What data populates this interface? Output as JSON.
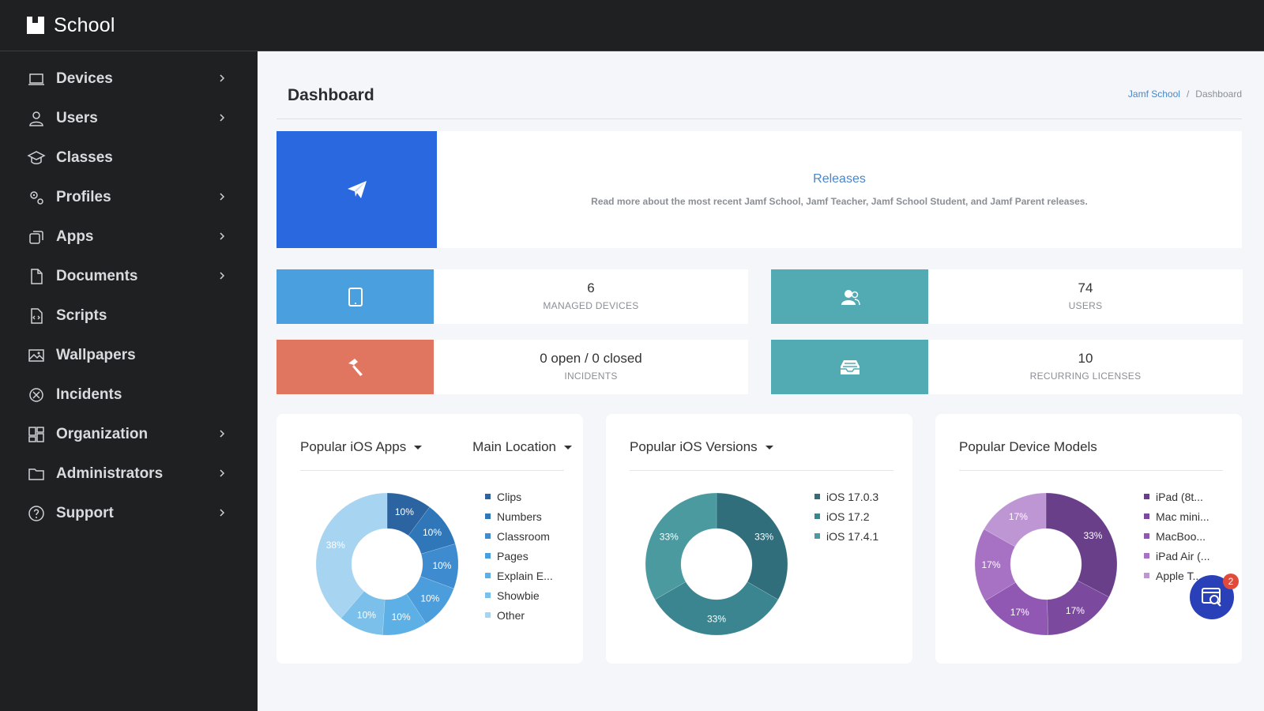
{
  "app": {
    "brand": "School"
  },
  "sidebar": {
    "items": [
      {
        "label": "Devices",
        "icon": "laptop-icon",
        "has_children": true
      },
      {
        "label": "Users",
        "icon": "user-icon",
        "has_children": true
      },
      {
        "label": "Classes",
        "icon": "graduation-cap-icon",
        "has_children": false
      },
      {
        "label": "Profiles",
        "icon": "gears-icon",
        "has_children": true
      },
      {
        "label": "Apps",
        "icon": "apps-icon",
        "has_children": true
      },
      {
        "label": "Documents",
        "icon": "document-icon",
        "has_children": true
      },
      {
        "label": "Scripts",
        "icon": "script-icon",
        "has_children": false
      },
      {
        "label": "Wallpapers",
        "icon": "image-icon",
        "has_children": false
      },
      {
        "label": "Incidents",
        "icon": "incidents-icon",
        "has_children": false
      },
      {
        "label": "Organization",
        "icon": "organization-icon",
        "has_children": true
      },
      {
        "label": "Administrators",
        "icon": "folder-icon",
        "has_children": true
      },
      {
        "label": "Support",
        "icon": "help-icon",
        "has_children": true
      }
    ]
  },
  "header": {
    "title": "Dashboard",
    "breadcrumb": {
      "root": "Jamf School",
      "current": "Dashboard"
    }
  },
  "releases": {
    "title": "Releases",
    "description": "Read more about the most recent Jamf School, Jamf Teacher, Jamf School Student, and Jamf Parent releases."
  },
  "stats": {
    "devices": {
      "value": "6",
      "label": "MANAGED DEVICES",
      "color": "#4a9fde"
    },
    "users": {
      "value": "74",
      "label": "USERS",
      "color": "#52aab3"
    },
    "incidents": {
      "value": "0 open / 0 closed",
      "label": "INCIDENTS",
      "color": "#e07560"
    },
    "licenses": {
      "value": "10",
      "label": "RECURRING LICENSES",
      "color": "#52aab3"
    }
  },
  "charts": {
    "apps": {
      "title": "Popular iOS Apps",
      "location": "Main Location"
    },
    "versions": {
      "title": "Popular iOS Versions"
    },
    "models": {
      "title": "Popular Device Models"
    }
  },
  "chart_data": [
    {
      "type": "pie",
      "title": "Popular iOS Apps",
      "categories": [
        "Clips",
        "Numbers",
        "Classroom",
        "Pages",
        "Explain E...",
        "Showbie",
        "Other"
      ],
      "values": [
        10,
        10,
        10,
        10,
        10,
        10,
        38
      ],
      "data_labels": [
        "10%",
        "10%",
        "10%",
        "10%",
        "10%",
        "10%",
        "38%"
      ],
      "colors": [
        "#2b64a0",
        "#2f77b9",
        "#3f8bcf",
        "#4c9ddc",
        "#5db0e6",
        "#7bc0ea",
        "#a6d4f1"
      ]
    },
    {
      "type": "pie",
      "title": "Popular iOS Versions",
      "categories": [
        "iOS 17.0.3",
        "iOS 17.2",
        "iOS 17.4.1"
      ],
      "values": [
        33,
        33,
        33
      ],
      "data_labels": [
        "33%",
        "33%",
        "33%"
      ],
      "colors": [
        "#2f6e7a",
        "#3a8590",
        "#4a9a9f"
      ]
    },
    {
      "type": "pie",
      "title": "Popular Device Models",
      "categories": [
        "iPad (8t...",
        "Mac mini...",
        "MacBoo...",
        "iPad Air (...",
        "Apple T..."
      ],
      "values": [
        33,
        17,
        17,
        17,
        17
      ],
      "data_labels": [
        "33%",
        "17%",
        "17%",
        "17%",
        "17%"
      ],
      "colors": [
        "#6a3f8a",
        "#7b4a9e",
        "#9158b3",
        "#a872c4",
        "#bf96d4"
      ]
    }
  ],
  "support_widget": {
    "badge": "2"
  }
}
